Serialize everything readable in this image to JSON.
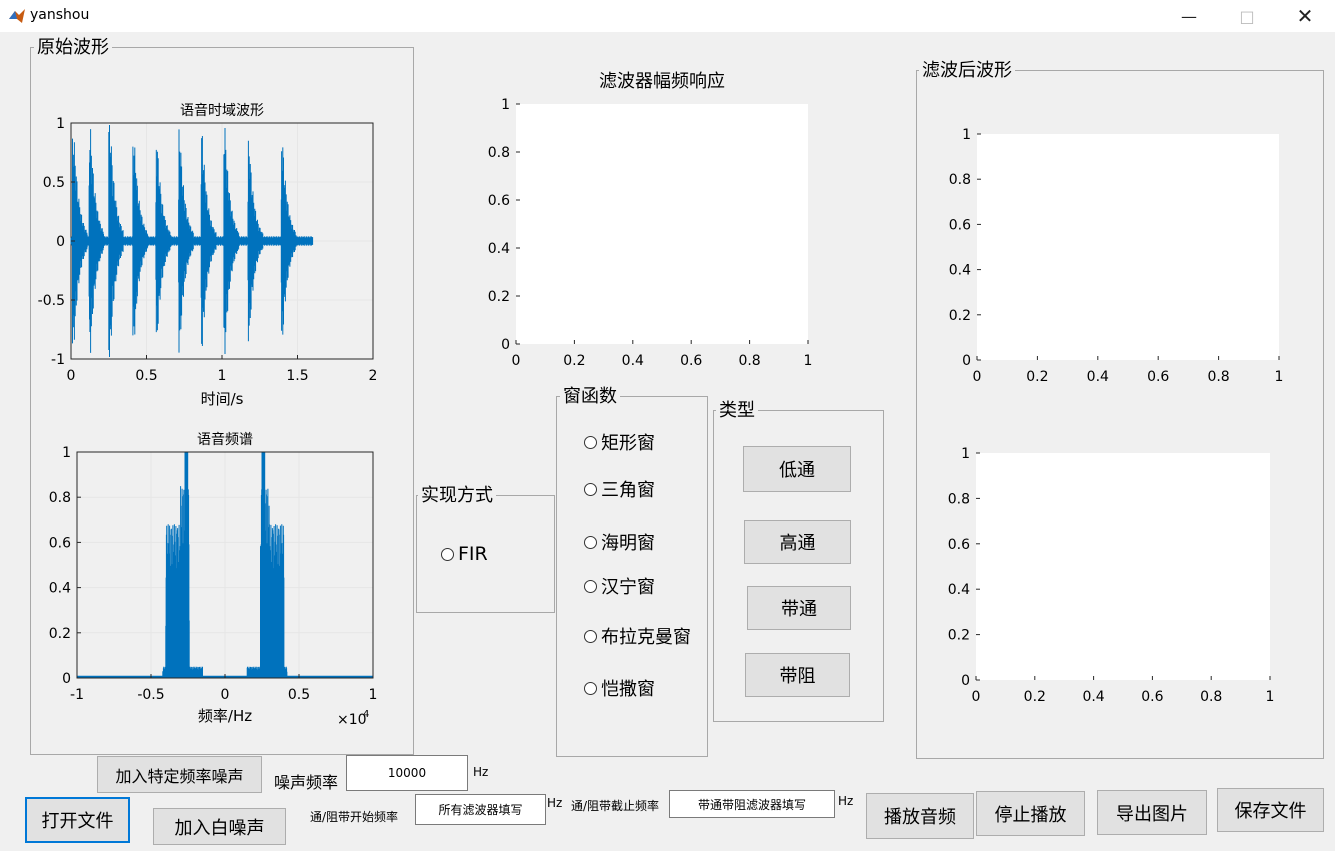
{
  "window": {
    "title": "yanshou"
  },
  "panels": {
    "original": "原始波形",
    "filtered": "滤波后波形",
    "impl": "实现方式",
    "window_fn": "窗函数",
    "type": "类型"
  },
  "filter_response": {
    "title": "滤波器幅频响应",
    "y_ticks": [
      "0",
      "0.2",
      "0.4",
      "0.6",
      "0.8",
      "1"
    ],
    "x_ticks": [
      "0",
      "0.2",
      "0.4",
      "0.6",
      "0.8",
      "1"
    ]
  },
  "time_plot": {
    "title": "语音时域波形",
    "xlabel": "时间/s",
    "y_ticks": [
      "-1",
      "-0.5",
      "0",
      "0.5",
      "1"
    ],
    "x_ticks": [
      "0",
      "0.5",
      "1",
      "1.5",
      "2"
    ]
  },
  "spectrum_plot": {
    "title": "语音频谱",
    "xlabel": "频率/Hz",
    "y_ticks": [
      "0",
      "0.2",
      "0.4",
      "0.6",
      "0.8",
      "1"
    ],
    "x_ticks": [
      "-1",
      "-0.5",
      "0",
      "0.5",
      "1"
    ],
    "exponent_base": "×10",
    "exponent_power": "4"
  },
  "filtered_top": {
    "y_ticks": [
      "0",
      "0.2",
      "0.4",
      "0.6",
      "0.8",
      "1"
    ],
    "x_ticks": [
      "0",
      "0.2",
      "0.4",
      "0.6",
      "0.8",
      "1"
    ]
  },
  "filtered_bottom": {
    "y_ticks": [
      "0",
      "0.2",
      "0.4",
      "0.6",
      "0.8",
      "1"
    ],
    "x_ticks": [
      "0",
      "0.2",
      "0.4",
      "0.6",
      "0.8",
      "1"
    ]
  },
  "impl_options": [
    "FIR"
  ],
  "window_options": [
    "矩形窗",
    "三角窗",
    "海明窗",
    "汉宁窗",
    "布拉克曼窗",
    "恺撒窗"
  ],
  "type_buttons": [
    "低通",
    "高通",
    "带通",
    "带阻"
  ],
  "controls": {
    "add_tone_noise": "加入特定频率噪声",
    "noise_freq_label": "噪声频率",
    "noise_freq_value": "10000",
    "hz": "Hz",
    "open_file": "打开文件",
    "add_white_noise": "加入白噪声",
    "pass_start_label": "通/阻带开始频率",
    "pass_start_value": "所有滤波器填写",
    "pass_stop_label": "通/阻带截止频率",
    "pass_stop_value": "带通带阻滤波器填写",
    "play": "播放音频",
    "stop": "停止播放",
    "export": "导出图片",
    "save": "保存文件"
  },
  "colors": {
    "waveform": "#0072bd",
    "grid": "#e6e6e6"
  }
}
